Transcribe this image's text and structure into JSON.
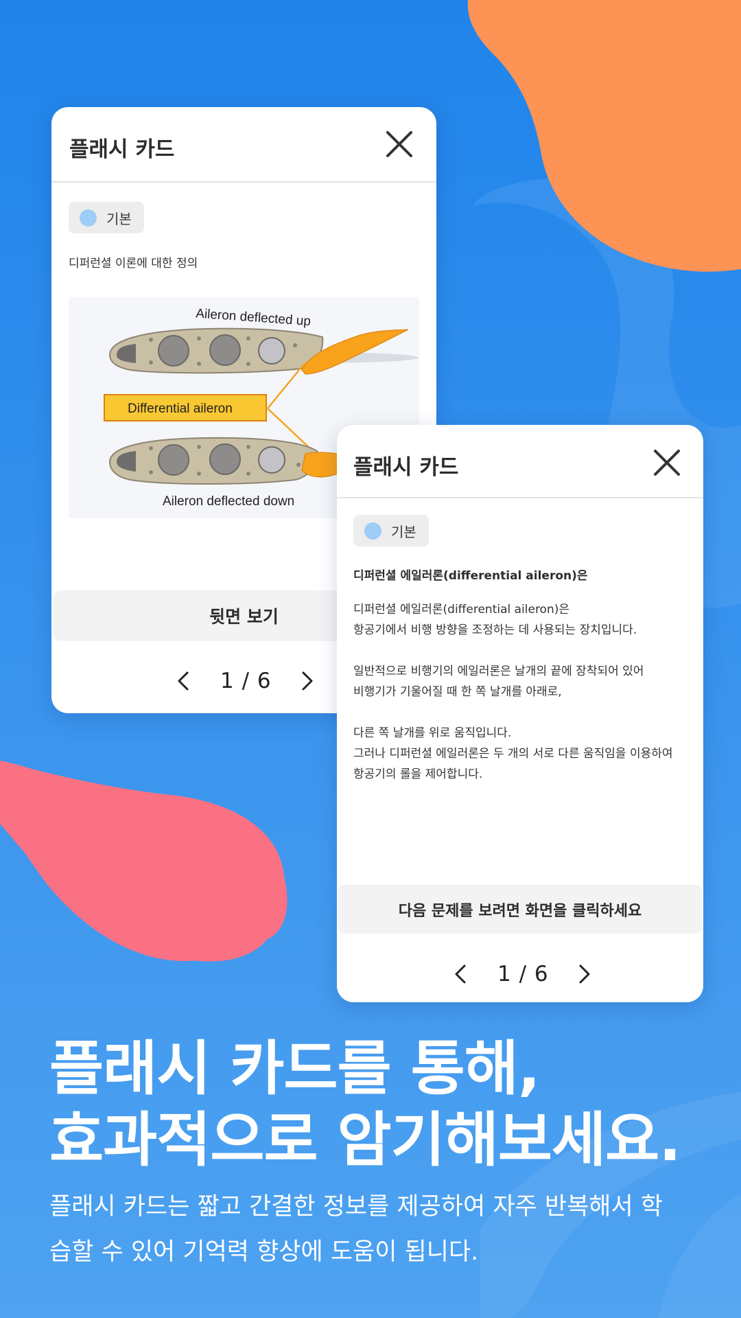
{
  "colors": {
    "background": "#2d8bec",
    "orange_blob": "#fe9356",
    "pink_blob": "#f97183",
    "chip_dot": "#9ecdf7",
    "aileron_orange": "#f9a21c"
  },
  "card_front": {
    "title": "플래시 카드",
    "close_icon": "close-icon",
    "chip_label": "기본",
    "description": "디퍼런셜 이론에 대한 정의",
    "figure": {
      "label_up": "Aileron deflected up",
      "label_center": "Differential aileron",
      "label_down": "Aileron deflected down"
    },
    "flip_button": "뒷면 보기",
    "pager": {
      "text": "1 / 6",
      "prev_icon": "chevron-left-icon",
      "next_icon": "chevron-right-icon"
    }
  },
  "card_back": {
    "title": "플래시 카드",
    "close_icon": "close-icon",
    "chip_label": "기본",
    "heading": "디퍼런셜 에일러론(differential aileron)은",
    "para1": [
      "디퍼런셜 에일러론(differential aileron)은",
      "항공기에서 비행 방향을 조정하는 데 사용되는 장치입니다."
    ],
    "para2": [
      "일반적으로 비행기의 에일러론은 날개의 끝에 장착되어 있어",
      "비행기가 기울어질 때 한 쪽 날개를 아래로,"
    ],
    "para3": [
      "다른 쪽 날개를 위로 움직입니다.",
      "그러나 디퍼런셜 에일러론은 두 개의 서로 다른 움직임을 이용하여",
      "항공기의 롤을 제어합니다."
    ],
    "next_hint": "다음 문제를 보려면 화면을 클릭하세요",
    "pager": {
      "text": "1 / 6",
      "prev_icon": "chevron-left-icon",
      "next_icon": "chevron-right-icon"
    }
  },
  "headline": [
    "플래시 카드를 통해,",
    "효과적으로 암기해보세요."
  ],
  "subline": [
    "플래시 카드는 짧고 간결한 정보를 제공하여 자주 반복해서 학",
    "습할 수 있어 기억력 향상에 도움이 됩니다."
  ]
}
